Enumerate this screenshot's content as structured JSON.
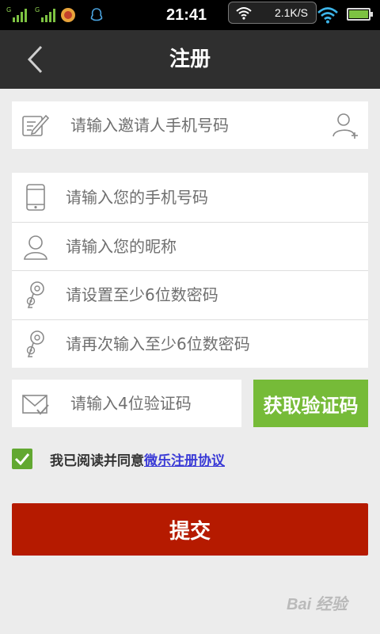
{
  "status_bar": {
    "time": "21:41",
    "network_speed": "2.1K/S",
    "signal1_label": "G",
    "signal2_label": "G"
  },
  "header": {
    "title": "注册"
  },
  "form": {
    "invite_placeholder": "请输入邀请人手机号码",
    "phone_placeholder": "请输入您的手机号码",
    "nickname_placeholder": "请输入您的昵称",
    "password_placeholder": "请设置至少6位数密码",
    "confirm_password_placeholder": "请再次输入至少6位数密码",
    "code_placeholder": "请输入4位验证码",
    "get_code_label": "获取验证码"
  },
  "agreement": {
    "checked": true,
    "text": "我已阅读并同意",
    "link": "微乐注册协议"
  },
  "submit_label": "提交",
  "watermark": "Bai 经验",
  "colors": {
    "header_bg": "#2f2f2f",
    "get_code_bg": "#76bb38",
    "checkbox": "#62a831",
    "submit_bg": "#b51a00",
    "link": "#3a3ad6"
  }
}
